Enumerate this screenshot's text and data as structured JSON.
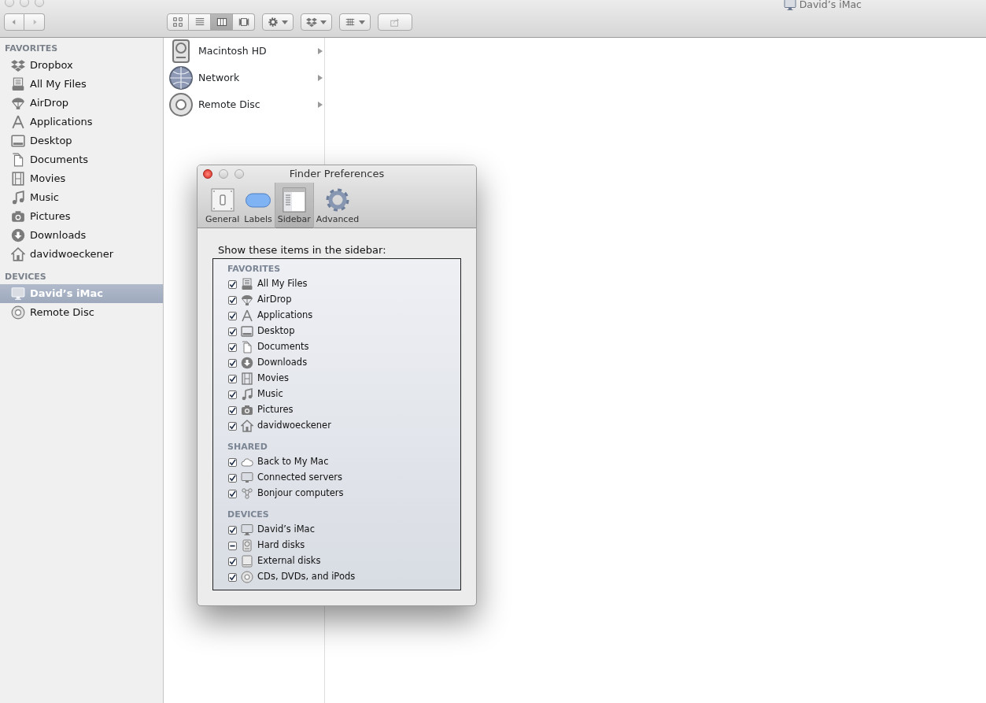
{
  "finder_window": {
    "title": "David’s iMac",
    "view_modes": [
      {
        "kind": "icons",
        "selected": false
      },
      {
        "kind": "list",
        "selected": false
      },
      {
        "kind": "columns",
        "selected": true
      },
      {
        "kind": "coverflow",
        "selected": false
      }
    ],
    "sidebar": [
      {
        "heading": "FAVORITES",
        "items": [
          {
            "label": "Dropbox",
            "kind": "dropbox",
            "selected": false
          },
          {
            "label": "All My Files",
            "kind": "files",
            "selected": false
          },
          {
            "label": "AirDrop",
            "kind": "airdrop",
            "selected": false
          },
          {
            "label": "Applications",
            "kind": "apps",
            "selected": false
          },
          {
            "label": "Desktop",
            "kind": "desktop",
            "selected": false
          },
          {
            "label": "Documents",
            "kind": "documents",
            "selected": false
          },
          {
            "label": "Movies",
            "kind": "movies",
            "selected": false
          },
          {
            "label": "Music",
            "kind": "music",
            "selected": false
          },
          {
            "label": "Pictures",
            "kind": "pictures",
            "selected": false
          },
          {
            "label": "Downloads",
            "kind": "downloads",
            "selected": false
          },
          {
            "label": "davidwoeckener",
            "kind": "home",
            "selected": false
          }
        ]
      },
      {
        "heading": "DEVICES",
        "items": [
          {
            "label": "David’s iMac",
            "kind": "imac",
            "selected": true
          },
          {
            "label": "Remote Disc",
            "kind": "disc",
            "selected": false
          }
        ]
      }
    ],
    "column_1": [
      {
        "label": "Macintosh HD",
        "kind": "hd"
      },
      {
        "label": "Network",
        "kind": "network"
      },
      {
        "label": "Remote Disc",
        "kind": "disc"
      }
    ]
  },
  "preferences_dialog": {
    "title": "Finder Preferences",
    "tabs": [
      {
        "label": "General",
        "kind": "general",
        "selected": false
      },
      {
        "label": "Labels",
        "kind": "labels",
        "selected": false
      },
      {
        "label": "Sidebar",
        "kind": "sidebar",
        "selected": true
      },
      {
        "label": "Advanced",
        "kind": "advanced",
        "selected": false
      }
    ],
    "prompt": "Show these items in the sidebar:",
    "groups": [
      {
        "heading": "FAVORITES",
        "items": [
          {
            "label": "All My Files",
            "kind": "files",
            "checked": true
          },
          {
            "label": "AirDrop",
            "kind": "airdrop",
            "checked": true
          },
          {
            "label": "Applications",
            "kind": "apps",
            "checked": true
          },
          {
            "label": "Desktop",
            "kind": "desktop",
            "checked": true
          },
          {
            "label": "Documents",
            "kind": "documents",
            "checked": true
          },
          {
            "label": "Downloads",
            "kind": "downloads",
            "checked": true
          },
          {
            "label": "Movies",
            "kind": "movies",
            "checked": true
          },
          {
            "label": "Music",
            "kind": "music",
            "checked": true
          },
          {
            "label": "Pictures",
            "kind": "pictures",
            "checked": true
          },
          {
            "label": "davidwoeckener",
            "kind": "home",
            "checked": true
          }
        ]
      },
      {
        "heading": "SHARED",
        "items": [
          {
            "label": "Back to My Mac",
            "kind": "cloud",
            "checked": true
          },
          {
            "label": "Connected servers",
            "kind": "server",
            "checked": true
          },
          {
            "label": "Bonjour computers",
            "kind": "bonjour",
            "checked": true
          }
        ]
      },
      {
        "heading": "DEVICES",
        "items": [
          {
            "label": "David’s iMac",
            "kind": "imac",
            "checked": true
          },
          {
            "label": "Hard disks",
            "kind": "hd",
            "checked": true,
            "mixed": true
          },
          {
            "label": "External disks",
            "kind": "external",
            "checked": true
          },
          {
            "label": "CDs, DVDs, and iPods",
            "kind": "disc",
            "checked": true
          }
        ]
      }
    ]
  }
}
